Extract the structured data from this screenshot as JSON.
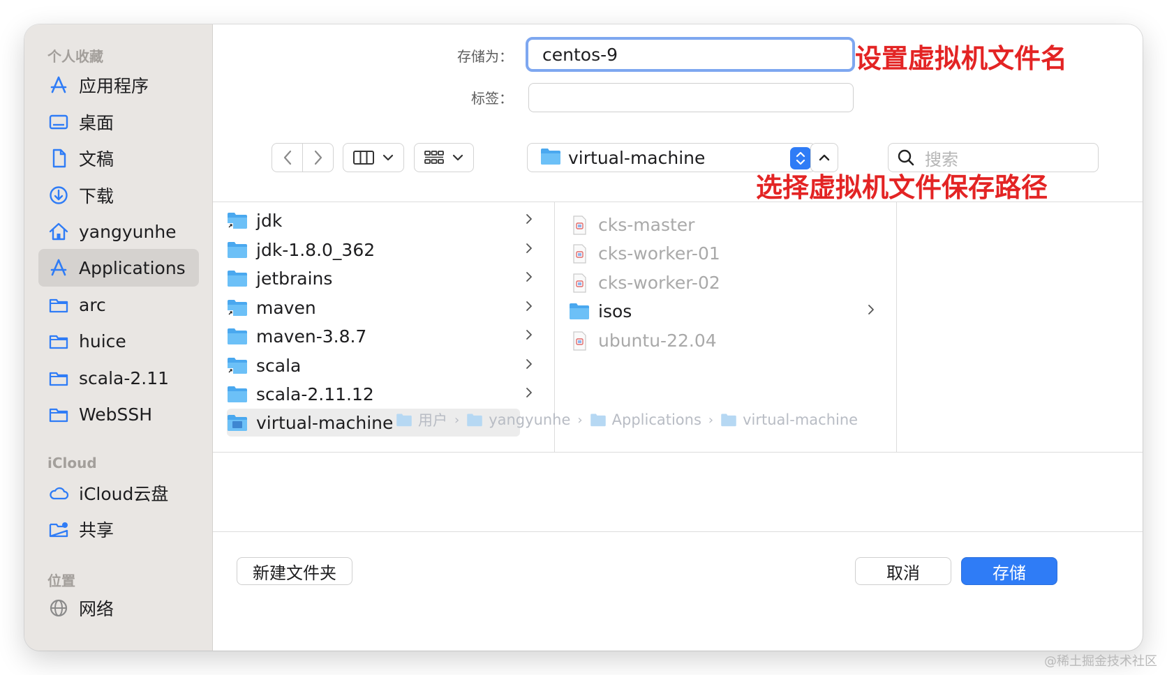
{
  "sidebar": {
    "favorites_header": "个人收藏",
    "favorites": [
      {
        "label": "应用程序",
        "icon": "apps-icon"
      },
      {
        "label": "桌面",
        "icon": "desktop-icon"
      },
      {
        "label": "文稿",
        "icon": "document-icon"
      },
      {
        "label": "下载",
        "icon": "download-icon"
      },
      {
        "label": "yangyunhe",
        "icon": "home-icon"
      },
      {
        "label": "Applications",
        "icon": "apps-icon",
        "selected": true
      },
      {
        "label": "arc",
        "icon": "folder-icon"
      },
      {
        "label": "huice",
        "icon": "folder-icon"
      },
      {
        "label": "scala-2.11",
        "icon": "folder-icon"
      },
      {
        "label": "WebSSH",
        "icon": "folder-icon"
      }
    ],
    "icloud_header": "iCloud",
    "icloud": [
      {
        "label": "iCloud云盘",
        "icon": "cloud-icon"
      },
      {
        "label": "共享",
        "icon": "shared-folder-icon"
      }
    ],
    "locations_header": "位置",
    "locations": [
      {
        "label": "网络",
        "icon": "network-icon"
      }
    ]
  },
  "form": {
    "save_as_label": "存储为：",
    "save_as_value": "centos-9",
    "tags_label": "标签：",
    "tags_value": ""
  },
  "annotations": {
    "name_note": "设置虚拟机文件名",
    "path_note": "选择虚拟机文件保存路径"
  },
  "toolbar": {
    "current_folder": "virtual-machine",
    "search_placeholder": "搜索",
    "accent": "#2f7cf6"
  },
  "browser": {
    "column1": [
      {
        "name": "jdk",
        "alias": true
      },
      {
        "name": "jdk-1.8.0_362",
        "alias": false
      },
      {
        "name": "jetbrains",
        "alias": false
      },
      {
        "name": "maven",
        "alias": true
      },
      {
        "name": "maven-3.8.7",
        "alias": false
      },
      {
        "name": "scala",
        "alias": true
      },
      {
        "name": "scala-2.11.12",
        "alias": false
      },
      {
        "name": "virtual-machine",
        "alias": false,
        "selected": true
      }
    ],
    "column2": [
      {
        "name": "cks-master",
        "type": "vm-file"
      },
      {
        "name": "cks-worker-01",
        "type": "vm-file"
      },
      {
        "name": "cks-worker-02",
        "type": "vm-file"
      },
      {
        "name": "isos",
        "type": "folder"
      },
      {
        "name": "ubuntu-22.04",
        "type": "vm-file"
      }
    ],
    "path_bar": [
      "用户",
      "yangyunhe",
      "Applications",
      "virtual-machine"
    ]
  },
  "buttons": {
    "new_folder": "新建文件夹",
    "cancel": "取消",
    "save": "存储"
  },
  "watermark": "@稀土掘金技术社区"
}
